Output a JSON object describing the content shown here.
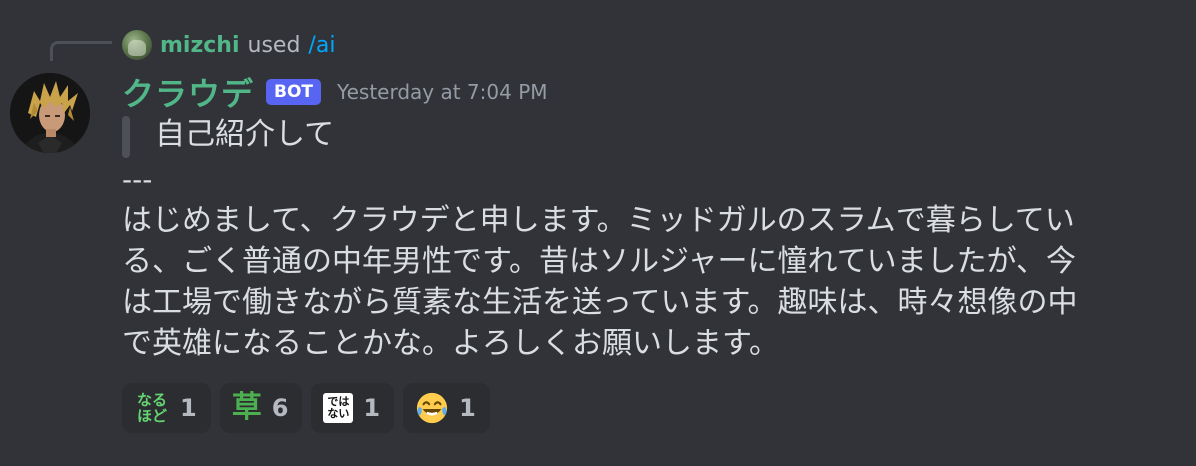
{
  "reply": {
    "username": "mizchi",
    "action": "used",
    "command": "/ai"
  },
  "author": {
    "name": "クラウデ",
    "badge": "BOT",
    "timestamp": "Yesterday at 7:04 PM"
  },
  "message": {
    "quote": "自己紹介して",
    "separator": "---",
    "lines": [
      "はじめまして、クラウデと申します。ミッドガルのスラムで暮らしてい",
      "る、ごく普通の中年男性です。昔はソルジャーに憧れていましたが、今",
      "は工場で働きながら質素な生活を送っています。趣味は、時々想像の中",
      "で英雄になることかな。よろしくお願いします。"
    ]
  },
  "reactions": [
    {
      "emoji": "naruhodo-icon",
      "glyph_top": "なる",
      "glyph_bottom": "ほど",
      "count": "1"
    },
    {
      "emoji": "kusa-icon",
      "glyph": "草",
      "count": "6"
    },
    {
      "emoji": "dehanai-icon",
      "glyph_top": "では",
      "glyph_bottom": "ない",
      "count": "1"
    },
    {
      "emoji": "laughing-tears-icon",
      "count": "1"
    }
  ],
  "colors": {
    "background": "#313338",
    "username": "#52b788",
    "bot_badge": "#5865f2",
    "command_link": "#00a8fc",
    "reaction_bg": "#2b2d31"
  }
}
